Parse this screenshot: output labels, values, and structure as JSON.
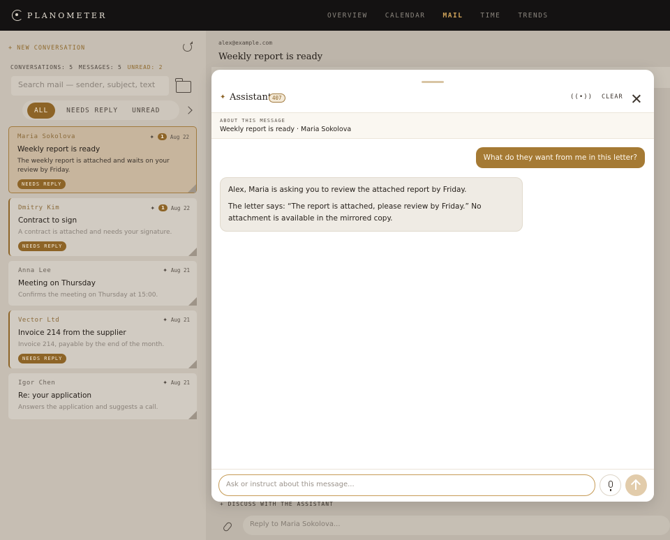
{
  "brand": {
    "name": "PLANOMETER"
  },
  "nav": {
    "items": [
      "OVERVIEW",
      "CALENDAR",
      "MAIL",
      "TIME",
      "TRENDS"
    ],
    "active": "MAIL"
  },
  "sidebar": {
    "new_conversation": "+ NEW CONVERSATION",
    "stats": {
      "conversations": "CONVERSATIONS: 5",
      "messages": "MESSAGES: 5",
      "unread": "UNREAD: 2"
    },
    "search_placeholder": "Search mail — sender, subject, text",
    "filters": [
      "ALL",
      "NEEDS REPLY",
      "UNREAD"
    ],
    "active_filter": "ALL",
    "mails": [
      {
        "sender": "Maria Sokolova",
        "count": "1",
        "date": "Aug 22",
        "subject": "Weekly report is ready",
        "preview": "The weekly report is attached and waits on your review by Friday.",
        "tag": "NEEDS REPLY"
      },
      {
        "sender": "Dmitry Kim",
        "count": "1",
        "date": "Aug 22",
        "subject": "Contract to sign",
        "preview": "A contract is attached and needs your signature.",
        "tag": "NEEDS REPLY"
      },
      {
        "sender": "Anna Lee",
        "date": "Aug 21",
        "subject": "Meeting on Thursday",
        "preview": "Confirms the meeting on Thursday at 15:00."
      },
      {
        "sender": "Vector Ltd",
        "date": "Aug 21",
        "subject": "Invoice 214 from the supplier",
        "preview": "Invoice 214, payable by the end of the month.",
        "tag": "NEEDS REPLY"
      },
      {
        "sender": "Igor Chen",
        "date": "Aug 21",
        "subject": "Re: your application",
        "preview": "Answers the application and suggests a call."
      }
    ]
  },
  "main": {
    "from": "alex@example.com",
    "subject": "Weekly report is ready",
    "discuss_link": "+ DISCUSS WITH THE ASSISTANT",
    "reply_placeholder": "Reply to Maria Sokolova..."
  },
  "assistant": {
    "title": "Assistant",
    "badge": "407",
    "live_label": "((•))",
    "clear_label": "CLEAR",
    "about_label": "ABOUT THIS MESSAGE",
    "about_value": "Weekly report is ready · Maria Sokolova",
    "user_message": "What do they want from me in this letter?",
    "reply_p1": "Alex, Maria is asking you to review the attached report by Friday.",
    "reply_p2": "The letter says: “The report is attached, please review by Friday.” No attachment is available in the mirrored copy.",
    "input_placeholder": "Ask or instruct about this message..."
  },
  "colors": {
    "accent": "#8d6427",
    "topbar": "#141212",
    "nav_active": "#d1a45a"
  }
}
